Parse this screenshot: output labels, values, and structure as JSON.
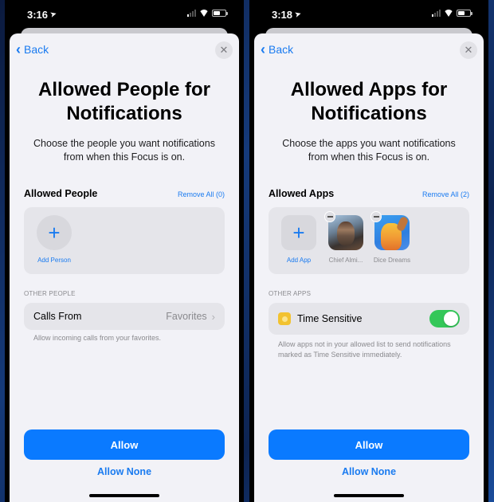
{
  "screens": [
    {
      "status": {
        "time": "3:16"
      },
      "nav": {
        "back_label": "Back",
        "close_icon": "close-icon"
      },
      "title": "Allowed People for Notifications",
      "subtitle": "Choose the people you want notifications from when this Focus is on.",
      "section": {
        "title": "Allowed People",
        "remove_all": "Remove All (0)"
      },
      "add_label": "Add Person",
      "other_label": "OTHER PEOPLE",
      "row": {
        "label": "Calls From",
        "value": "Favorites"
      },
      "footnote": "Allow incoming calls from your favorites.",
      "allow_label": "Allow",
      "allow_none_label": "Allow None"
    },
    {
      "status": {
        "time": "3:18"
      },
      "nav": {
        "back_label": "Back",
        "close_icon": "close-icon"
      },
      "title": "Allowed Apps for Notifications",
      "subtitle": "Choose the apps you want notifications from when this Focus is on.",
      "section": {
        "title": "Allowed Apps",
        "remove_all": "Remove All (2)"
      },
      "add_label": "Add App",
      "apps": [
        {
          "name": "Chief Almi...",
          "icon": "chief-almighty-app-icon"
        },
        {
          "name": "Dice Dreams",
          "icon": "dice-dreams-app-icon"
        }
      ],
      "other_label": "OTHER APPS",
      "row": {
        "label": "Time Sensitive",
        "toggle_on": true
      },
      "footnote": "Allow apps not in your allowed list to send notifications marked as Time Sensitive immediately.",
      "allow_label": "Allow",
      "allow_none_label": "Allow None"
    }
  ],
  "colors": {
    "accent": "#0a7aff",
    "toggle_on": "#34c759",
    "sheet_bg": "#f2f2f7",
    "group_bg": "#e5e5ea"
  }
}
